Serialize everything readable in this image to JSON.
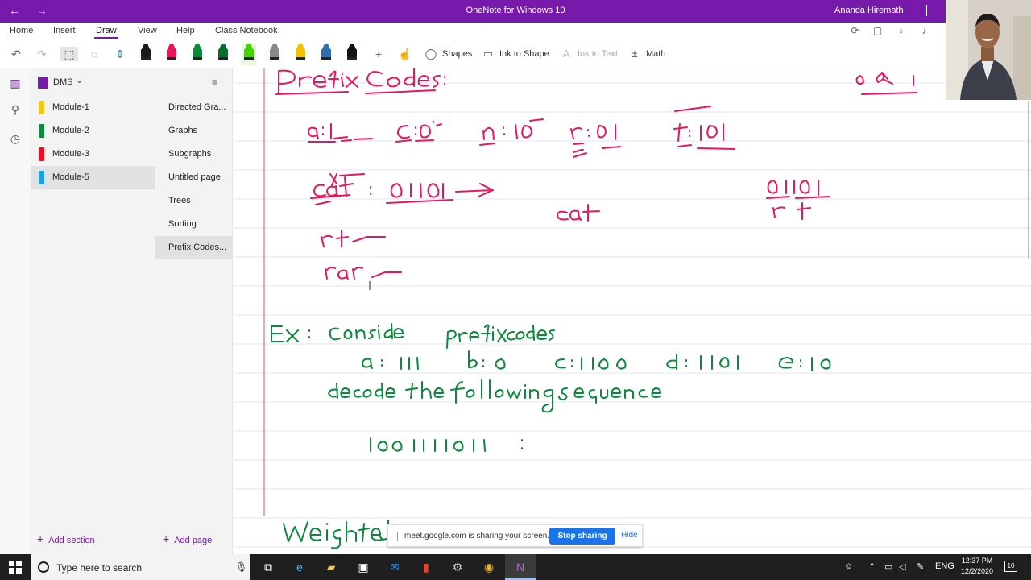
{
  "window": {
    "title": "OneNote for Windows 10",
    "user": "Ananda Hiremath"
  },
  "ribbon": {
    "tabs": [
      "Home",
      "Insert",
      "Draw",
      "View",
      "Help",
      "Class Notebook"
    ],
    "active_tab": "Draw"
  },
  "toolbar": {
    "shapes_label": "Shapes",
    "ink_to_shape_label": "Ink to Shape",
    "ink_to_text_label": "Ink to Text",
    "math_label": "Math",
    "pens": [
      {
        "name": "black-pen",
        "color": "#1a1a1a"
      },
      {
        "name": "pink-pen",
        "color": "#e8175d"
      },
      {
        "name": "green-pen",
        "color": "#0a8a3a"
      },
      {
        "name": "dark-green-pen",
        "color": "#0b6b2e"
      },
      {
        "name": "lime-highlighter",
        "color": "#42d400"
      },
      {
        "name": "gray-pen",
        "color": "#888888"
      },
      {
        "name": "yellow-pen",
        "color": "#f2c200"
      },
      {
        "name": "blue-pen",
        "color": "#2f6fb0"
      },
      {
        "name": "black-pen-2",
        "color": "#111111"
      }
    ]
  },
  "notebook": {
    "name": "DMS",
    "sections": [
      {
        "label": "Module-1",
        "color": "#f2c811",
        "selected": false
      },
      {
        "label": "Module-2",
        "color": "#10893e",
        "selected": false
      },
      {
        "label": "Module-3",
        "color": "#e81123",
        "selected": false
      },
      {
        "label": "Module-5",
        "color": "#1ba1e2",
        "selected": true
      }
    ],
    "pages": [
      {
        "label": "Directed Gra...",
        "selected": false
      },
      {
        "label": "Graphs",
        "selected": false
      },
      {
        "label": "Subgraphs",
        "selected": false
      },
      {
        "label": "Untitled page",
        "selected": false
      },
      {
        "label": "Trees",
        "selected": false
      },
      {
        "label": "Sorting",
        "selected": false
      },
      {
        "label": "Prefix Codes...",
        "selected": true
      }
    ],
    "add_section_label": "Add section",
    "add_page_label": "Add page"
  },
  "sharing_bar": {
    "message": "meet.google.com is sharing your screen.",
    "stop_label": "Stop sharing",
    "hide_label": "Hide"
  },
  "taskbar": {
    "search_placeholder": "Type here to search",
    "language": "ENG",
    "time": "12:37 PM",
    "date": "12/2/2020",
    "notification_count": "10"
  },
  "colors": {
    "accent": "#7719aa",
    "ink_pink": "#e8175d",
    "ink_green": "#0a8a3a",
    "margin_line": "#d9534f"
  }
}
